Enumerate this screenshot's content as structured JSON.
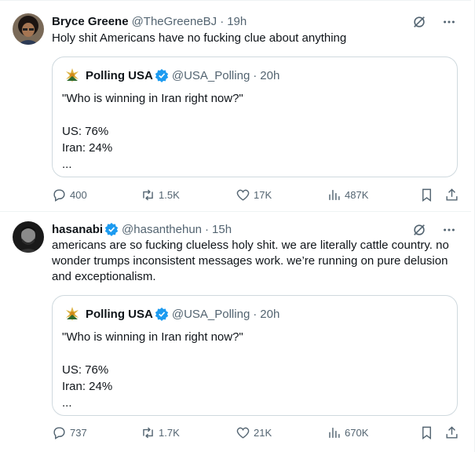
{
  "colors": {
    "text": "#0f1419",
    "muted": "#536471",
    "verified": "#1d9bf0",
    "border": "#cfd9de"
  },
  "tweets": [
    {
      "author": {
        "name": "Bryce Greene",
        "handle": "@TheGreeneBJ",
        "time": "19h",
        "verified": false
      },
      "text": "Holy shit Americans have no fucking clue about anything",
      "quote": {
        "author": {
          "name": "Polling USA",
          "handle": "@USA_Polling",
          "time": "20h",
          "verified": true
        },
        "lines": [
          "\"Who is winning in Iran right now?\"",
          "",
          "US: 76%",
          "Iran: 24%",
          "..."
        ]
      },
      "metrics": {
        "replies": "400",
        "reposts": "1.5K",
        "likes": "17K",
        "views": "487K"
      }
    },
    {
      "author": {
        "name": "hasanabi",
        "handle": "@hasanthehun",
        "time": "15h",
        "verified": true
      },
      "text": "americans are so fucking clueless holy shit. we are literally cattle country. no wonder trumps inconsistent messages work. we’re running on pure delusion and exceptionalism.",
      "quote": {
        "author": {
          "name": "Polling USA",
          "handle": "@USA_Polling",
          "time": "20h",
          "verified": true
        },
        "lines": [
          "\"Who is winning in Iran right now?\"",
          "",
          "US: 76%",
          "Iran: 24%",
          "..."
        ]
      },
      "metrics": {
        "replies": "737",
        "reposts": "1.7K",
        "likes": "21K",
        "views": "670K"
      }
    }
  ],
  "icons": {
    "top_actions": [
      "grok-icon",
      "more-icon"
    ],
    "metric_icons": [
      "reply-icon",
      "repost-icon",
      "like-icon",
      "views-icon",
      "bookmark-icon",
      "share-icon"
    ]
  },
  "separator": "·"
}
